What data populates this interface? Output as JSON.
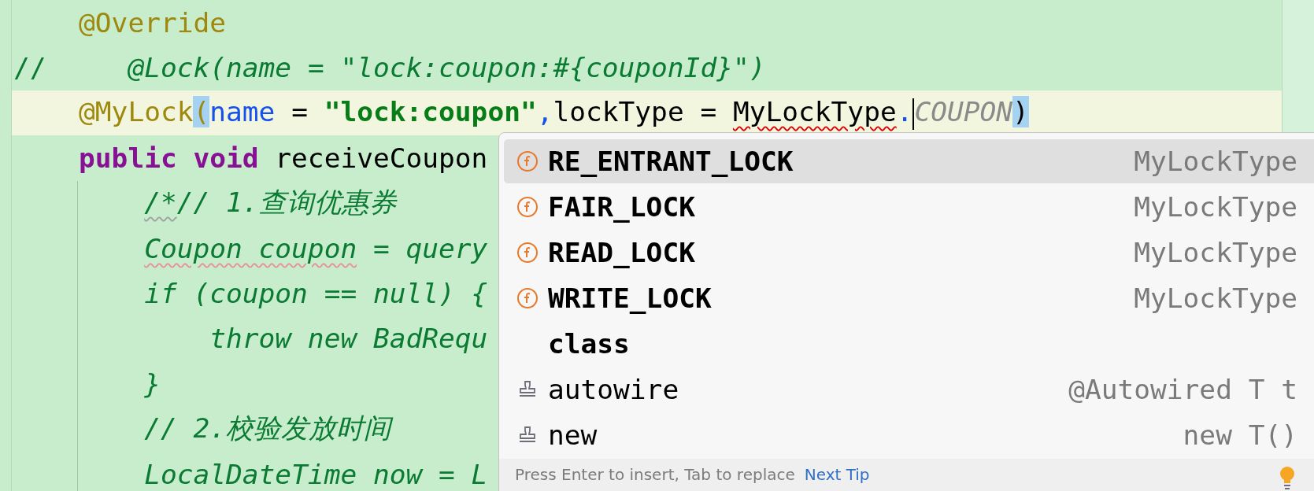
{
  "editor": {
    "lines": [
      {
        "kind": "member",
        "current": false,
        "segments": [
          {
            "text": "@Override",
            "kind": "annotation"
          }
        ]
      },
      {
        "kind": "flush",
        "current": false,
        "segments": [
          {
            "text": "//",
            "kind": "comment"
          },
          {
            "text": "     @Lock(name = \"lock:coupon:#{couponId}\")",
            "kind": "comment-italic"
          }
        ]
      },
      {
        "kind": "member",
        "current": true,
        "segments": [
          {
            "text": "@MyLock",
            "kind": "annotation"
          },
          {
            "text": "(",
            "kind": "annotation",
            "brace_match": true
          },
          {
            "text": "name",
            "kind": "param"
          },
          {
            "text": " = "
          },
          {
            "text": "\"lock:coupon\"",
            "kind": "string"
          },
          {
            "text": ",",
            "kind": "param"
          },
          {
            "text": "lockType = "
          },
          {
            "text": "MyLockType",
            "error": true
          },
          {
            "text": ".",
            "kind": "param"
          },
          {
            "text": "COUPON",
            "kind": "ghost",
            "caret_before": true
          },
          {
            "text": ")",
            "brace_match": true
          }
        ]
      },
      {
        "kind": "member",
        "current": false,
        "segments": [
          {
            "text": "public void",
            "kind": "keyword"
          },
          {
            "text": " receiveCoupon"
          }
        ]
      },
      {
        "kind": "body",
        "current": false,
        "segments": [
          {
            "text": "/*",
            "kind": "comment-italic",
            "typo": true
          },
          {
            "text": "// 1.查询优惠券",
            "kind": "comment-italic"
          }
        ]
      },
      {
        "kind": "body",
        "current": false,
        "segments": [
          {
            "text": "Coupon coupon",
            "kind": "comment-italic",
            "warning": true
          },
          {
            "text": " = query",
            "kind": "comment-italic"
          }
        ]
      },
      {
        "kind": "body",
        "current": false,
        "segments": [
          {
            "text": "if (coupon == null) {",
            "kind": "comment-italic"
          }
        ]
      },
      {
        "kind": "nested",
        "current": false,
        "segments": [
          {
            "text": "throw new BadRequ",
            "kind": "comment-italic"
          }
        ]
      },
      {
        "kind": "body",
        "current": false,
        "segments": [
          {
            "text": "}",
            "kind": "comment-italic"
          }
        ]
      },
      {
        "kind": "body",
        "current": false,
        "segments": [
          {
            "text": "// 2.校验发放时间",
            "kind": "comment-italic"
          }
        ]
      },
      {
        "kind": "body",
        "current": false,
        "segments": [
          {
            "text": "LocalDateTime now = L",
            "kind": "comment-italic"
          }
        ]
      }
    ]
  },
  "completion_popup": {
    "items": [
      {
        "kind": "field",
        "name": "RE_ENTRANT_LOCK",
        "type": "MyLockType",
        "selected": true
      },
      {
        "kind": "field",
        "name": "FAIR_LOCK",
        "type": "MyLockType",
        "selected": false
      },
      {
        "kind": "field",
        "name": "READ_LOCK",
        "type": "MyLockType",
        "selected": false
      },
      {
        "kind": "field",
        "name": "WRITE_LOCK",
        "type": "MyLockType",
        "selected": false
      },
      {
        "kind": "keyword",
        "name": "class",
        "selected": false
      },
      {
        "kind": "template",
        "name": "autowire",
        "type": "@Autowired T t",
        "selected": false
      },
      {
        "kind": "template",
        "name": "new",
        "type": "new T()",
        "selected": false
      }
    ],
    "footer": {
      "hint": "Press Enter to insert, Tab to replace",
      "link": "Next Tip"
    }
  }
}
